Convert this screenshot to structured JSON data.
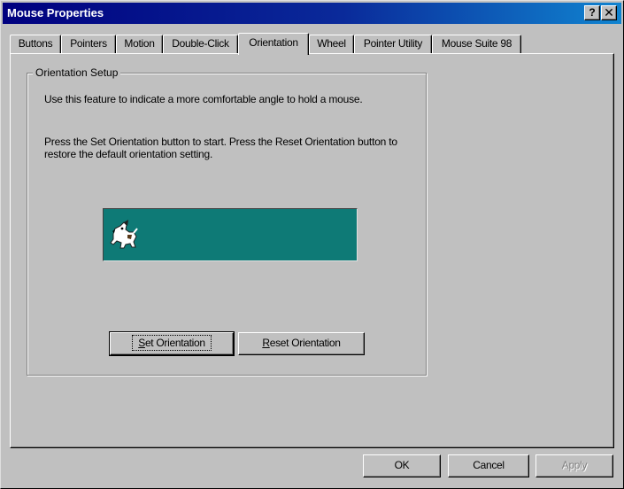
{
  "window": {
    "title": "Mouse Properties",
    "help_glyph": "?",
    "close_glyph": "✕"
  },
  "tabs": [
    {
      "label": "Buttons",
      "active": false
    },
    {
      "label": "Pointers",
      "active": false
    },
    {
      "label": "Motion",
      "active": false
    },
    {
      "label": "Double-Click",
      "active": false
    },
    {
      "label": "Orientation",
      "active": true
    },
    {
      "label": "Wheel",
      "active": false
    },
    {
      "label": "Pointer Utility",
      "active": false
    },
    {
      "label": "Mouse Suite 98",
      "active": false
    }
  ],
  "orientation": {
    "group_label": "Orientation Setup",
    "description": "Use this feature to indicate a more comfortable angle to hold a mouse.",
    "instructions": "Press the Set Orientation button to start. Press the Reset Orientation button to restore the default orientation setting.",
    "preview_color": "#0e7a76",
    "preview_icon": "dog-mascot-icon",
    "set_button": {
      "mnemonic": "S",
      "rest": "et Orientation"
    },
    "reset_button": {
      "mnemonic": "R",
      "rest": "eset Orientation"
    }
  },
  "footer": {
    "ok_label": "OK",
    "cancel_label": "Cancel",
    "apply_label": "Apply"
  },
  "colors": {
    "face": "#c0c0c0",
    "titlebar_start": "#00007f",
    "titlebar_end": "#1084d0"
  }
}
